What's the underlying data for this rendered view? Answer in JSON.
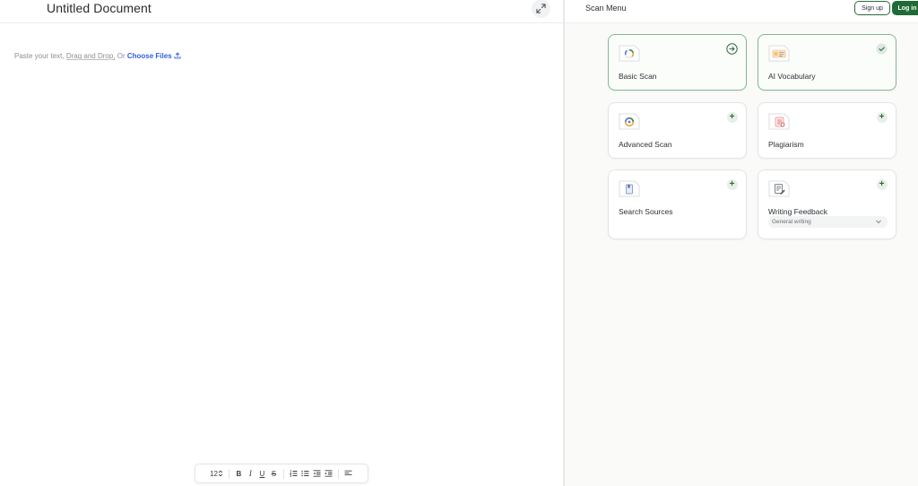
{
  "editor": {
    "title": "Untitled Document",
    "hint": {
      "prefix": "Paste your text, ",
      "drag_drop": "Drag and Drop,",
      "or": " Or ",
      "choose_files": "Choose Files"
    },
    "toolbar": {
      "font_size": "12",
      "bold": "B",
      "italic": "I",
      "underline": "U",
      "strike": "S"
    }
  },
  "scan_menu": {
    "title": "Scan Menu",
    "sign_up": "Sign up",
    "log_in": "Log in",
    "cards": [
      {
        "label": "Basic Scan",
        "action": "arrow-right-circle-icon",
        "selected": true
      },
      {
        "label": "AI Vocabulary",
        "action": "check-circle-icon",
        "selected": true
      },
      {
        "label": "Advanced Scan",
        "action": "plus-icon",
        "selected": false
      },
      {
        "label": "Plagiarism",
        "action": "plus-icon",
        "selected": false
      },
      {
        "label": "Search Sources",
        "action": "plus-icon",
        "selected": false
      },
      {
        "label": "Writing Feedback",
        "action": "plus-icon",
        "selected": false,
        "dropdown_value": "General writing"
      }
    ]
  },
  "colors": {
    "brand_green": "#1e6b35",
    "link_blue": "#2f5fe0",
    "selected_border": "#86b792"
  }
}
